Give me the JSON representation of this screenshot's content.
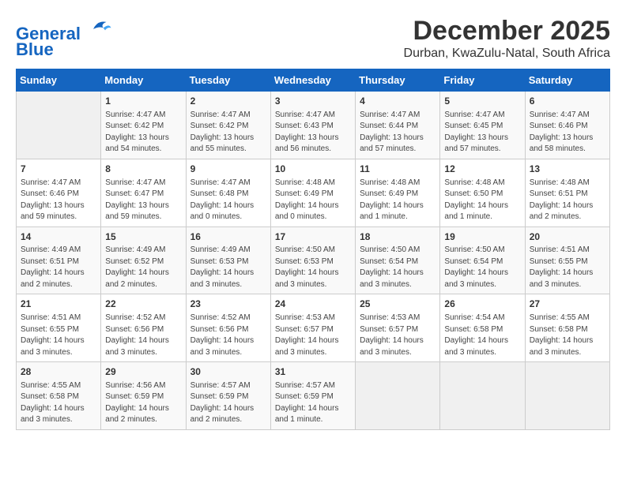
{
  "logo": {
    "line1": "General",
    "line2": "Blue"
  },
  "title": "December 2025",
  "subtitle": "Durban, KwaZulu-Natal, South Africa",
  "weekdays": [
    "Sunday",
    "Monday",
    "Tuesday",
    "Wednesday",
    "Thursday",
    "Friday",
    "Saturday"
  ],
  "weeks": [
    [
      {
        "day": "",
        "info": ""
      },
      {
        "day": "1",
        "info": "Sunrise: 4:47 AM\nSunset: 6:42 PM\nDaylight: 13 hours\nand 54 minutes."
      },
      {
        "day": "2",
        "info": "Sunrise: 4:47 AM\nSunset: 6:42 PM\nDaylight: 13 hours\nand 55 minutes."
      },
      {
        "day": "3",
        "info": "Sunrise: 4:47 AM\nSunset: 6:43 PM\nDaylight: 13 hours\nand 56 minutes."
      },
      {
        "day": "4",
        "info": "Sunrise: 4:47 AM\nSunset: 6:44 PM\nDaylight: 13 hours\nand 57 minutes."
      },
      {
        "day": "5",
        "info": "Sunrise: 4:47 AM\nSunset: 6:45 PM\nDaylight: 13 hours\nand 57 minutes."
      },
      {
        "day": "6",
        "info": "Sunrise: 4:47 AM\nSunset: 6:46 PM\nDaylight: 13 hours\nand 58 minutes."
      }
    ],
    [
      {
        "day": "7",
        "info": "Sunrise: 4:47 AM\nSunset: 6:46 PM\nDaylight: 13 hours\nand 59 minutes."
      },
      {
        "day": "8",
        "info": "Sunrise: 4:47 AM\nSunset: 6:47 PM\nDaylight: 13 hours\nand 59 minutes."
      },
      {
        "day": "9",
        "info": "Sunrise: 4:47 AM\nSunset: 6:48 PM\nDaylight: 14 hours\nand 0 minutes."
      },
      {
        "day": "10",
        "info": "Sunrise: 4:48 AM\nSunset: 6:49 PM\nDaylight: 14 hours\nand 0 minutes."
      },
      {
        "day": "11",
        "info": "Sunrise: 4:48 AM\nSunset: 6:49 PM\nDaylight: 14 hours\nand 1 minute."
      },
      {
        "day": "12",
        "info": "Sunrise: 4:48 AM\nSunset: 6:50 PM\nDaylight: 14 hours\nand 1 minute."
      },
      {
        "day": "13",
        "info": "Sunrise: 4:48 AM\nSunset: 6:51 PM\nDaylight: 14 hours\nand 2 minutes."
      }
    ],
    [
      {
        "day": "14",
        "info": "Sunrise: 4:49 AM\nSunset: 6:51 PM\nDaylight: 14 hours\nand 2 minutes."
      },
      {
        "day": "15",
        "info": "Sunrise: 4:49 AM\nSunset: 6:52 PM\nDaylight: 14 hours\nand 2 minutes."
      },
      {
        "day": "16",
        "info": "Sunrise: 4:49 AM\nSunset: 6:53 PM\nDaylight: 14 hours\nand 3 minutes."
      },
      {
        "day": "17",
        "info": "Sunrise: 4:50 AM\nSunset: 6:53 PM\nDaylight: 14 hours\nand 3 minutes."
      },
      {
        "day": "18",
        "info": "Sunrise: 4:50 AM\nSunset: 6:54 PM\nDaylight: 14 hours\nand 3 minutes."
      },
      {
        "day": "19",
        "info": "Sunrise: 4:50 AM\nSunset: 6:54 PM\nDaylight: 14 hours\nand 3 minutes."
      },
      {
        "day": "20",
        "info": "Sunrise: 4:51 AM\nSunset: 6:55 PM\nDaylight: 14 hours\nand 3 minutes."
      }
    ],
    [
      {
        "day": "21",
        "info": "Sunrise: 4:51 AM\nSunset: 6:55 PM\nDaylight: 14 hours\nand 3 minutes."
      },
      {
        "day": "22",
        "info": "Sunrise: 4:52 AM\nSunset: 6:56 PM\nDaylight: 14 hours\nand 3 minutes."
      },
      {
        "day": "23",
        "info": "Sunrise: 4:52 AM\nSunset: 6:56 PM\nDaylight: 14 hours\nand 3 minutes."
      },
      {
        "day": "24",
        "info": "Sunrise: 4:53 AM\nSunset: 6:57 PM\nDaylight: 14 hours\nand 3 minutes."
      },
      {
        "day": "25",
        "info": "Sunrise: 4:53 AM\nSunset: 6:57 PM\nDaylight: 14 hours\nand 3 minutes."
      },
      {
        "day": "26",
        "info": "Sunrise: 4:54 AM\nSunset: 6:58 PM\nDaylight: 14 hours\nand 3 minutes."
      },
      {
        "day": "27",
        "info": "Sunrise: 4:55 AM\nSunset: 6:58 PM\nDaylight: 14 hours\nand 3 minutes."
      }
    ],
    [
      {
        "day": "28",
        "info": "Sunrise: 4:55 AM\nSunset: 6:58 PM\nDaylight: 14 hours\nand 3 minutes."
      },
      {
        "day": "29",
        "info": "Sunrise: 4:56 AM\nSunset: 6:59 PM\nDaylight: 14 hours\nand 2 minutes."
      },
      {
        "day": "30",
        "info": "Sunrise: 4:57 AM\nSunset: 6:59 PM\nDaylight: 14 hours\nand 2 minutes."
      },
      {
        "day": "31",
        "info": "Sunrise: 4:57 AM\nSunset: 6:59 PM\nDaylight: 14 hours\nand 1 minute."
      },
      {
        "day": "",
        "info": ""
      },
      {
        "day": "",
        "info": ""
      },
      {
        "day": "",
        "info": ""
      }
    ]
  ]
}
